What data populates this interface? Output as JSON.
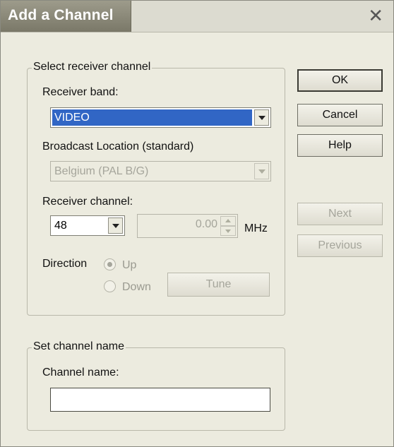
{
  "window": {
    "title": "Add a Channel"
  },
  "receiver_group": {
    "legend": "Select receiver channel",
    "band_label": "Receiver band:",
    "band_value": "VIDEO",
    "location_label": "Broadcast Location (standard)",
    "location_value": "Belgium (PAL B/G)",
    "channel_label": "Receiver channel:",
    "channel_value": "48",
    "frequency_value": "0.00",
    "frequency_unit": "MHz",
    "direction_label": "Direction",
    "direction_options": [
      "Up",
      "Down"
    ],
    "direction_selected": "Up",
    "tune_label": "Tune"
  },
  "name_group": {
    "legend": "Set channel name",
    "channel_name_label": "Channel name:",
    "channel_name_value": ""
  },
  "buttons": {
    "ok": "OK",
    "cancel": "Cancel",
    "help": "Help",
    "next": "Next",
    "previous": "Previous"
  },
  "colors": {
    "selection": "#3166c5",
    "dialog_bg": "#ecebdf",
    "title_tab": "#8a8878"
  },
  "icons": {
    "close": "close-icon",
    "dropdown": "chevron-down-icon",
    "spin_up": "spin-up-icon",
    "spin_down": "spin-down-icon"
  }
}
